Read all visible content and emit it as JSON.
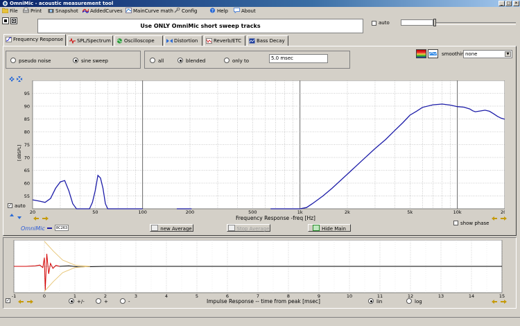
{
  "window": {
    "title": "OmniMic - acoustic measurement tool",
    "controls": [
      "_",
      "□",
      "✕"
    ]
  },
  "menu": [
    {
      "label": "File",
      "icon": "folder-icon"
    },
    {
      "label": "Print",
      "icon": "printer-icon"
    },
    {
      "label": "Snapshot",
      "icon": "camera-icon"
    },
    {
      "label": "AddedCurves",
      "icon": "curves-icon"
    },
    {
      "label": "MainCurve math",
      "icon": "math-icon"
    },
    {
      "label": "Config",
      "icon": "wrench-icon"
    },
    {
      "label": "Help",
      "icon": "help-icon"
    },
    {
      "label": "About",
      "icon": "about-icon"
    }
  ],
  "banner": "Use ONLY OmniMic short sweep tracks",
  "top_right": {
    "auto_label": "auto",
    "auto_checked": false
  },
  "tabs": [
    {
      "label": "Frequency Response",
      "active": true
    },
    {
      "label": "SPL/Spectrum",
      "active": false
    },
    {
      "label": "Oscilloscope",
      "active": false
    },
    {
      "label": "Distortion",
      "active": false
    },
    {
      "label": "Reverb/ETC",
      "active": false
    },
    {
      "label": "Bass Decay",
      "active": false
    }
  ],
  "signal": {
    "options": [
      "pseudo noise",
      "sine sweep"
    ],
    "selected": "sine sweep"
  },
  "window_mode": {
    "options": [
      "all",
      "blended",
      "only to"
    ],
    "selected": "blended",
    "time_value": "5.0 msec"
  },
  "smoothing": {
    "label": "smoothing",
    "value": "none"
  },
  "freq_chart_controls": {
    "auto_label": "auto",
    "auto_checked": true,
    "omnimic_label": "OmniMic",
    "mic_id": "8C263",
    "new_average": "new Average",
    "stop_average": "Stop Average",
    "hide_main": "Hide Main",
    "show_phase": "show phase"
  },
  "impulse_controls": {
    "scale_options": [
      "+/-",
      "+",
      "-"
    ],
    "scale_selected": "+/-",
    "axis_options": [
      "lin",
      "log"
    ],
    "axis_selected": "lin"
  },
  "chart_data": [
    {
      "type": "line",
      "xlabel": "Frequency Response -freq [Hz]",
      "ylabel": "[dBSPL]",
      "xscale": "log",
      "xlim": [
        20,
        20000
      ],
      "ylim": [
        50,
        100
      ],
      "xticks": [
        "20",
        "50",
        "100",
        "200",
        "500",
        "1k",
        "2k",
        "5k",
        "10k",
        "20k"
      ],
      "yticks": [
        "55",
        "60",
        "65",
        "70",
        "75",
        "80",
        "85",
        "90",
        "95"
      ],
      "grid": true,
      "color": "#1c1ca8",
      "segments": [
        [
          [
            20,
            53.5
          ],
          [
            22,
            53
          ],
          [
            24,
            52.5
          ],
          [
            26,
            54
          ],
          [
            28,
            58
          ],
          [
            30,
            60.5
          ],
          [
            32,
            61
          ],
          [
            34,
            57
          ],
          [
            36,
            52
          ],
          [
            38,
            46.5
          ],
          [
            40,
            48
          ],
          [
            42,
            44
          ],
          [
            44,
            48
          ],
          [
            46,
            44
          ],
          [
            48,
            52.5
          ],
          [
            50,
            57
          ],
          [
            52,
            63
          ],
          [
            54,
            62
          ],
          [
            56,
            58
          ],
          [
            58,
            52
          ],
          [
            60,
            49
          ],
          [
            63,
            45.5
          ],
          [
            66,
            49
          ],
          [
            70,
            47
          ],
          [
            74,
            45.5
          ],
          [
            78,
            47
          ],
          [
            82,
            48
          ],
          [
            86,
            46
          ],
          [
            90,
            49
          ],
          [
            95,
            47
          ],
          [
            100,
            45
          ]
        ],
        [
          [
            165,
            45
          ],
          [
            175,
            48
          ],
          [
            185,
            48.5
          ],
          [
            195,
            47
          ],
          [
            205,
            45
          ]
        ],
        [
          [
            650,
            45
          ],
          [
            750,
            45.5
          ],
          [
            850,
            46.5
          ],
          [
            950,
            48.5
          ],
          [
            1000,
            49.5
          ],
          [
            1100,
            50.5
          ],
          [
            1200,
            52
          ],
          [
            1400,
            55
          ],
          [
            1600,
            58
          ],
          [
            2000,
            63.5
          ],
          [
            2500,
            69
          ],
          [
            3000,
            73.5
          ],
          [
            3500,
            77
          ],
          [
            4000,
            80.5
          ],
          [
            4500,
            83.5
          ],
          [
            5000,
            86.5
          ],
          [
            5500,
            88
          ],
          [
            6000,
            89.5
          ],
          [
            7000,
            90.5
          ],
          [
            8000,
            90.8
          ],
          [
            9000,
            90.4
          ],
          [
            10000,
            89.8
          ],
          [
            11000,
            89.6
          ],
          [
            12000,
            88.9
          ],
          [
            12500,
            88.2
          ],
          [
            13000,
            87.8
          ],
          [
            14000,
            88.1
          ],
          [
            15000,
            88.4
          ],
          [
            16000,
            88
          ],
          [
            17000,
            87
          ],
          [
            18000,
            86
          ],
          [
            19000,
            85.3
          ],
          [
            20000,
            84.9
          ]
        ]
      ]
    },
    {
      "type": "line",
      "xlabel": "Impulse Response  -- time from peak [msec]",
      "xlim": [
        -1,
        15
      ],
      "ylim": [
        -1,
        1
      ],
      "xticks": [
        "-1",
        "0",
        "1",
        "2",
        "3",
        "4",
        "5",
        "6",
        "7",
        "8",
        "9",
        "10",
        "11",
        "12",
        "13",
        "14",
        "15"
      ],
      "grid": true,
      "series": [
        {
          "color": "#d40000",
          "values": [
            [
              -1,
              0
            ],
            [
              -0.6,
              0
            ],
            [
              -0.3,
              0.02
            ],
            [
              -0.15,
              0.05
            ],
            [
              -0.05,
              -0.05
            ],
            [
              0,
              0.35
            ],
            [
              0.03,
              -0.95
            ],
            [
              0.08,
              0.5
            ],
            [
              0.14,
              -0.3
            ],
            [
              0.2,
              0.12
            ],
            [
              0.28,
              -0.08
            ],
            [
              0.38,
              0.04
            ],
            [
              0.5,
              0
            ]
          ]
        },
        {
          "color": "#000000",
          "values": [
            [
              0.5,
              0
            ],
            [
              0.8,
              0.02
            ],
            [
              1.1,
              -0.02
            ],
            [
              2,
              0
            ],
            [
              15,
              0
            ]
          ]
        },
        {
          "color": "#e8c77a",
          "values": [
            [
              0,
              1
            ],
            [
              0.3,
              0.6
            ],
            [
              0.6,
              0.25
            ],
            [
              1,
              0.05
            ],
            [
              1.5,
              0
            ]
          ]
        },
        {
          "color": "#e8c77a",
          "values": [
            [
              0,
              -1
            ],
            [
              0.3,
              -0.6
            ],
            [
              0.6,
              -0.25
            ],
            [
              1,
              -0.05
            ],
            [
              1.5,
              0
            ]
          ]
        }
      ]
    }
  ]
}
